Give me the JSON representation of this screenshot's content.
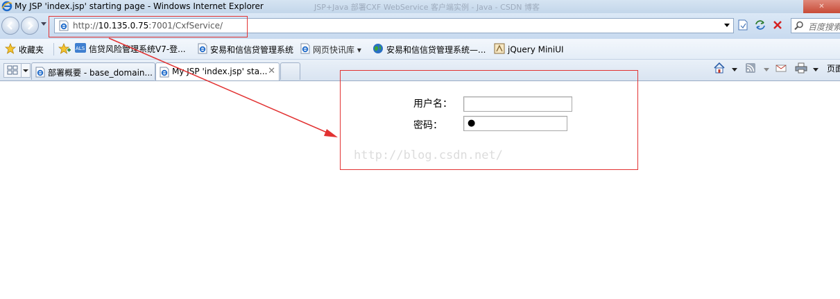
{
  "window": {
    "title": "My JSP 'index.jsp' starting page - Windows Internet Explorer",
    "background_title": "JSP+Java 部署CXF WebService 客户端实例 - Java - CSDN 博客"
  },
  "address_bar": {
    "url_prefix": "http://",
    "url_host": "10.135.0.75",
    "url_rest": ":7001/CxfService/"
  },
  "search": {
    "placeholder": "百度搜索"
  },
  "favorites_bar": {
    "favorites_label": "收藏夹",
    "items": [
      {
        "label": "信贷风险管理系统V7-登...",
        "icon": "als-icon"
      },
      {
        "label": "安易和信信贷管理系统",
        "icon": "ie-page-icon"
      },
      {
        "label": "网页快讯库 ▾",
        "icon": "web-slice-icon"
      },
      {
        "label": "安易和信信贷管理系统—...",
        "icon": "globe-icon"
      },
      {
        "label": "jQuery MiniUI",
        "icon": "miniui-icon"
      }
    ]
  },
  "tabs": [
    {
      "label": "部署概要 - base_domain..."
    },
    {
      "label": "My JSP 'index.jsp' sta...",
      "active": true
    }
  ],
  "command_bar": {
    "page_label": "页面"
  },
  "login_form": {
    "username_label": "用户名：",
    "password_label": "密码：",
    "username_value": "",
    "password_mask": "●"
  },
  "watermark": "http://blog.csdn.net/",
  "colors": {
    "annotation_red": "#e23232",
    "chrome_blue": "#c8daef"
  }
}
